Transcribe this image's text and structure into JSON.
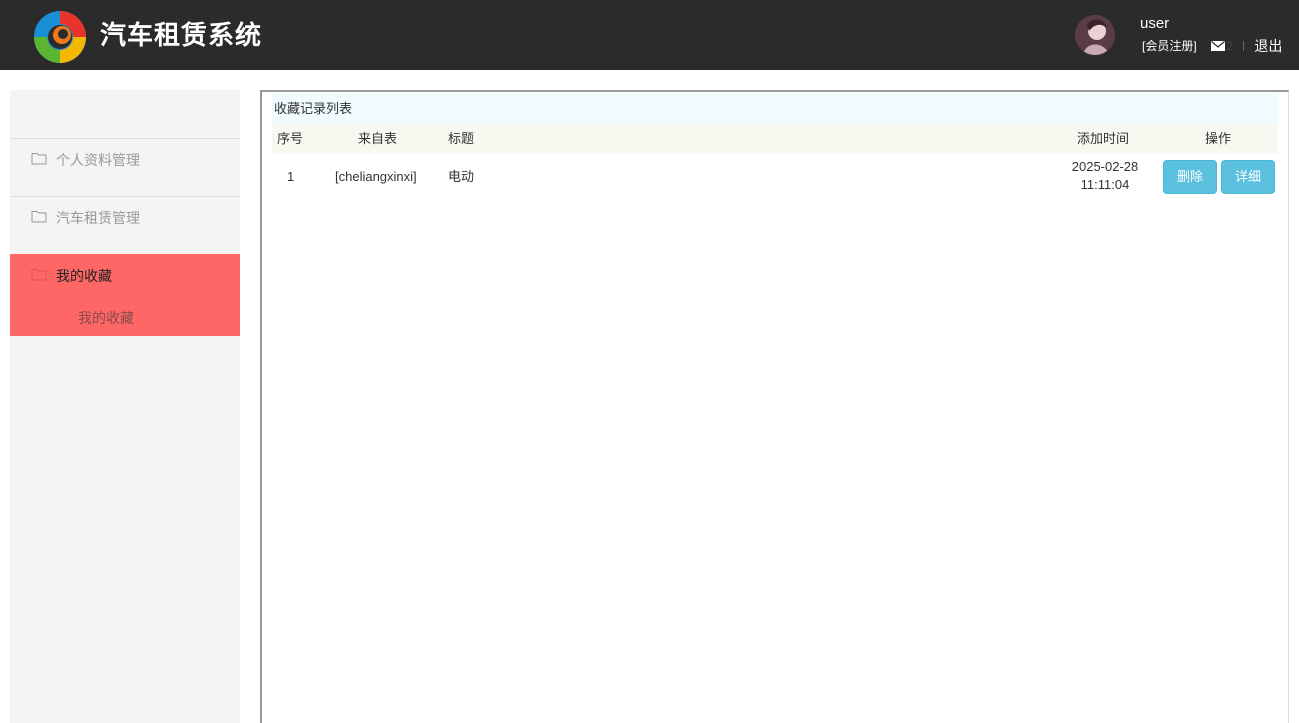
{
  "header": {
    "title": "汽车租赁系统",
    "username": "user",
    "register_link": "[会员注册]",
    "message_count": "2",
    "logout": "退出"
  },
  "sidebar": {
    "items": [
      {
        "label": "个人资料管理",
        "icon": "folder-icon"
      },
      {
        "label": "汽车租赁管理",
        "icon": "folder-icon"
      },
      {
        "label": "我的收藏",
        "icon": "folder-icon",
        "active": true,
        "children": [
          {
            "label": "我的收藏"
          }
        ]
      }
    ]
  },
  "main": {
    "panel_title": "收藏记录列表",
    "columns": [
      "序号",
      "来自表",
      "标题",
      "添加时间",
      "操作"
    ],
    "rows": [
      {
        "index": "1",
        "source": "[cheliangxinxi]",
        "title": "电动",
        "date": "2025-02-28",
        "time": "11:11:04",
        "delete_label": "删除",
        "detail_label": "详细"
      }
    ]
  },
  "colors": {
    "header_bg": "#2b2b2b",
    "active_menu": "#ff6666",
    "button": "#5bc0de"
  }
}
